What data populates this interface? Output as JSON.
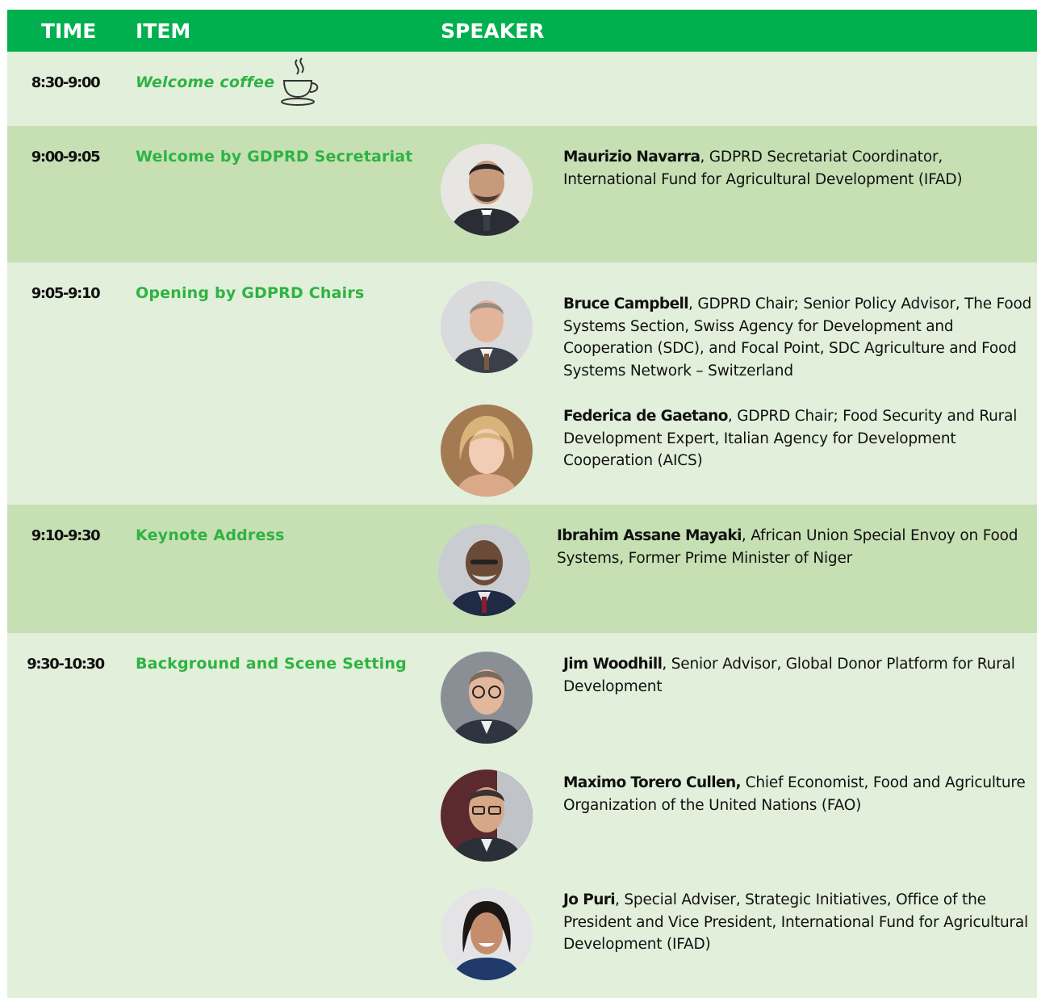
{
  "header": {
    "time": "TIME",
    "item": "ITEM",
    "speaker": "SPEAKER"
  },
  "colors": {
    "header_bg": "#00b04f",
    "row_light": "#e2efda",
    "row_dark": "#c6e0b4",
    "item_green": "#2eb342"
  },
  "rows": [
    {
      "time": "8:30-9:00",
      "item": "Welcome coffee",
      "icon": "coffee-cup-icon"
    },
    {
      "time": "9:00-9:05",
      "item": "Welcome by GDPRD Secretariat",
      "speakers": [
        {
          "name": "Maurizio Navarra",
          "role": ", GDPRD Secretariat Coordinator, International Fund for Agricultural Development (IFAD)"
        }
      ]
    },
    {
      "time": "9:05-9:10",
      "item": "Opening by GDPRD Chairs",
      "speakers": [
        {
          "name": "Bruce Campbell",
          "role": ", GDPRD Chair; Senior Policy Advisor, The Food Systems Section, Swiss Agency for Development and Cooperation (SDC), and Focal Point, SDC Agriculture and Food Systems Network – Switzerland"
        },
        {
          "name": "Federica de Gaetano",
          "role": ", GDPRD Chair; Food Security and Rural Development Expert, Italian Agency for Development Cooperation (AICS)"
        }
      ]
    },
    {
      "time": "9:10-9:30",
      "item": "Keynote Address",
      "speakers": [
        {
          "name": "Ibrahim Assane Mayaki",
          "role": ", African Union Special Envoy on Food Systems, Former Prime Minister of Niger"
        }
      ]
    },
    {
      "time": "9:30-10:30",
      "item": "Background and Scene Setting",
      "speakers": [
        {
          "name": "Jim Woodhill",
          "role": ", Senior Advisor, Global Donor Platform for Rural Development"
        },
        {
          "name": "Maximo Torero Cullen,",
          "role": " Chief Economist, Food and Agriculture Organization of the United Nations (FAO)"
        },
        {
          "name": "Jo Puri",
          "role": ", Special Adviser, Strategic Initiatives, Office of the President and Vice President, International Fund for Agricultural Development (IFAD)"
        }
      ]
    }
  ]
}
